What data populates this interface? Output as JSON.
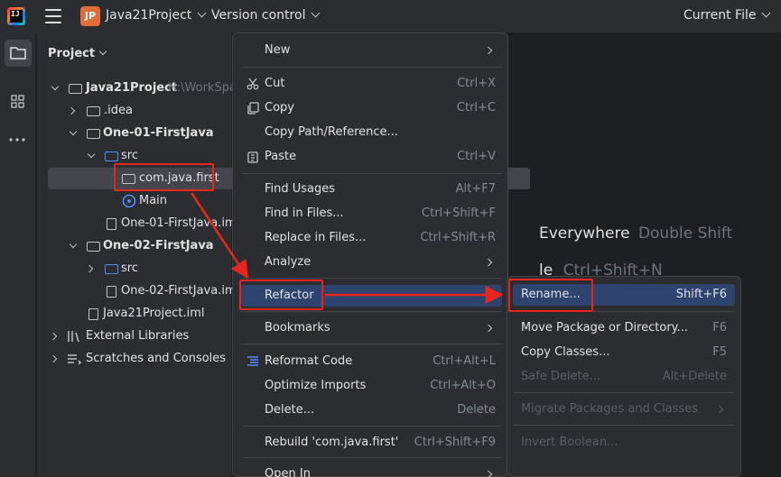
{
  "titlebar": {
    "project_badge": "JP",
    "project_name": "Java21Project",
    "vcs": "Version control",
    "run_config": "Current File"
  },
  "panel": {
    "title": "Project"
  },
  "tree": {
    "root": {
      "name": "Java21Project",
      "path": "H:\\WorkSpa"
    },
    "idea": ".idea",
    "mod1": "One-01-FirstJava",
    "src1": "src",
    "pkg": "com.java.first",
    "main": "Main",
    "iml1": "One-01-FirstJava.iml",
    "mod2": "One-02-FirstJava",
    "src2": "src",
    "iml2": "One-02-FirstJava.iml",
    "rootiml": "Java21Project.iml",
    "extlib": "External Libraries",
    "scratches": "Scratches and Consoles"
  },
  "editor_hints": {
    "search_label": "Everywhere",
    "search_key": "Double Shift",
    "file_label": "le",
    "file_key": "Ctrl+Shift+N"
  },
  "context_menu": {
    "items": [
      {
        "label": "New",
        "mnemonic": "N",
        "rest": "ew",
        "shortcut": ""
      },
      {
        "label": "Cut",
        "shortcut": "Ctrl+X"
      },
      {
        "label": "Copy",
        "shortcut": "Ctrl+C"
      },
      {
        "label": "Copy Path/Reference...",
        "shortcut": ""
      },
      {
        "label": "Paste",
        "shortcut": "Ctrl+V"
      },
      {
        "label": "Find Usages",
        "shortcut": "Alt+F7"
      },
      {
        "label": "Find in Files...",
        "shortcut": "Ctrl+Shift+F"
      },
      {
        "label": "Replace in Files...",
        "shortcut": "Ctrl+Shift+R"
      },
      {
        "label": "Analyze",
        "shortcut": ""
      },
      {
        "label": "Refactor",
        "shortcut": ""
      },
      {
        "label": "Bookmarks",
        "shortcut": ""
      },
      {
        "label": "Reformat Code",
        "shortcut": "Ctrl+Alt+L"
      },
      {
        "label": "Optimize Imports",
        "shortcut": "Ctrl+Alt+O"
      },
      {
        "label": "Delete...",
        "shortcut": "Delete"
      },
      {
        "label": "Rebuild 'com.java.first'",
        "shortcut": "Ctrl+Shift+F9"
      },
      {
        "label": "Open In",
        "shortcut": ""
      }
    ]
  },
  "refactor_submenu": {
    "items": [
      {
        "label": "Rename...",
        "shortcut": "Shift+F6"
      },
      {
        "label": "Move Package or Directory...",
        "shortcut": "F6"
      },
      {
        "label": "Copy Classes...",
        "shortcut": "F5"
      },
      {
        "label": "Safe Delete...",
        "shortcut": "Alt+Delete"
      },
      {
        "label": "Migrate Packages and Classes",
        "shortcut": ""
      },
      {
        "label": "Invert Boolean...",
        "shortcut": ""
      }
    ]
  },
  "colors": {
    "highlight": "#2e436e",
    "annotation": "#e8251f",
    "background": "#1e1f22",
    "panel": "#2b2d30"
  }
}
